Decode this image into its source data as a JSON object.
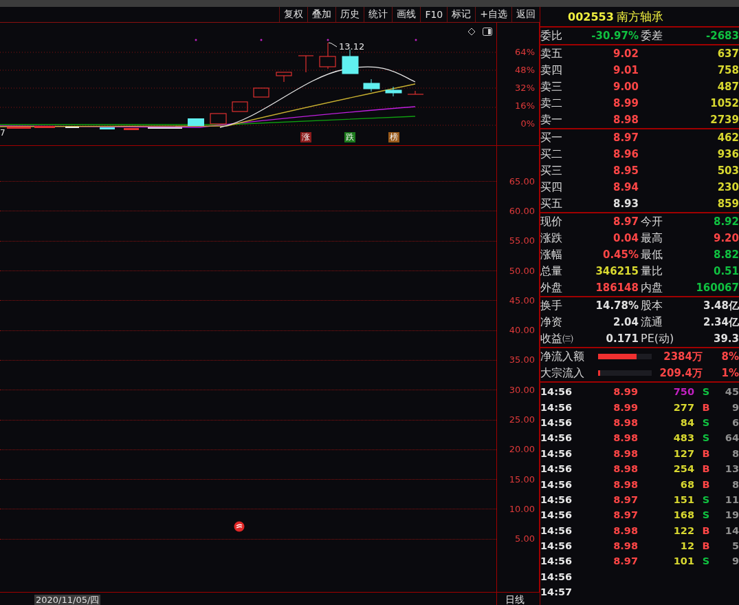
{
  "toolbar": [
    "复权",
    "叠加",
    "历史",
    "统计",
    "画线",
    "F10",
    "标记",
    "+自选",
    "返回"
  ],
  "top_chart": {
    "price_label": "13.12",
    "edge_label": "7",
    "axis_labels": [
      "64%",
      "48%",
      "32%",
      "16%",
      "0%"
    ],
    "markers": [
      {
        "label": "涨",
        "color": "#8c1c1c"
      },
      {
        "label": "跌",
        "color": "#1c7a1c"
      },
      {
        "label": "榜",
        "color": "#9a5a1a"
      }
    ]
  },
  "lower_chart": {
    "axis_labels": [
      "65.00",
      "60.00",
      "55.00",
      "50.00",
      "45.00",
      "40.00",
      "35.00",
      "30.00",
      "25.00",
      "20.00",
      "15.00",
      "10.00",
      "5.00"
    ]
  },
  "date_label": "2020/11/05/四",
  "period_label": "日线",
  "quote": {
    "code": "002553",
    "name": "南方轴承"
  },
  "ratio_row": [
    {
      "label": "委比",
      "value": "-30.97%",
      "color": "#10c040"
    },
    {
      "label": "委差",
      "value": "-2683",
      "color": "#10c040"
    }
  ],
  "asks": [
    {
      "label": "卖五",
      "price": "9.02",
      "color": "#ff4646",
      "volume": "637"
    },
    {
      "label": "卖四",
      "price": "9.01",
      "color": "#ff4646",
      "volume": "758"
    },
    {
      "label": "卖三",
      "price": "9.00",
      "color": "#ff4646",
      "volume": "487"
    },
    {
      "label": "卖二",
      "price": "8.99",
      "color": "#ff4646",
      "volume": "1052"
    },
    {
      "label": "卖一",
      "price": "8.98",
      "color": "#ff4646",
      "volume": "2739"
    }
  ],
  "bids": [
    {
      "label": "买一",
      "price": "8.97",
      "color": "#ff4646",
      "volume": "462"
    },
    {
      "label": "买二",
      "price": "8.96",
      "color": "#ff4646",
      "volume": "936"
    },
    {
      "label": "买三",
      "price": "8.95",
      "color": "#ff4646",
      "volume": "503"
    },
    {
      "label": "买四",
      "price": "8.94",
      "color": "#ff4646",
      "volume": "230"
    },
    {
      "label": "买五",
      "price": "8.93",
      "color": "#e0e0e0",
      "volume": "859"
    }
  ],
  "stats": [
    [
      {
        "label": "现价",
        "value": "8.97",
        "color": "#ff4646"
      },
      {
        "label": "今开",
        "value": "8.92",
        "color": "#10c040"
      }
    ],
    [
      {
        "label": "涨跌",
        "value": "0.04",
        "color": "#ff4646"
      },
      {
        "label": "最高",
        "value": "9.20",
        "color": "#ff4646"
      }
    ],
    [
      {
        "label": "涨幅",
        "value": "0.45%",
        "color": "#ff4646"
      },
      {
        "label": "最低",
        "value": "8.82",
        "color": "#10c040"
      }
    ],
    [
      {
        "label": "总量",
        "value": "346215",
        "color": "#d8d830"
      },
      {
        "label": "量比",
        "value": "0.51",
        "color": "#10c040"
      }
    ],
    [
      {
        "label": "外盘",
        "value": "186148",
        "color": "#ff4646"
      },
      {
        "label": "内盘",
        "value": "160067",
        "color": "#10c040"
      }
    ]
  ],
  "capital": [
    [
      {
        "label": "换手",
        "value": "14.78%"
      },
      {
        "label": "股本",
        "value": "3.48亿"
      }
    ],
    [
      {
        "label": "净资",
        "value": "2.04"
      },
      {
        "label": "流通",
        "value": "2.34亿"
      }
    ],
    [
      {
        "label": "收益㈢",
        "value": "0.171"
      },
      {
        "label": "PE(动)",
        "value": "39.3"
      }
    ]
  ],
  "fund_flow": [
    {
      "label": "净流入额",
      "level": 0.72,
      "amount": "2384万",
      "percent": "8%"
    },
    {
      "label": "大宗流入",
      "level": 0.04,
      "amount": "209.4万",
      "percent": "1%"
    }
  ],
  "trades": [
    {
      "time": "14:56",
      "price": "8.99",
      "volume": {
        "text": "750",
        "color": "#c020c0"
      },
      "side": {
        "text": "S",
        "color": "#10c040"
      },
      "count": "45"
    },
    {
      "time": "14:56",
      "price": "8.99",
      "volume": {
        "text": "277",
        "color": "#d8d830"
      },
      "side": {
        "text": "B",
        "color": "#ff4646"
      },
      "count": "9"
    },
    {
      "time": "14:56",
      "price": "8.98",
      "volume": {
        "text": "84",
        "color": "#d8d830"
      },
      "side": {
        "text": "S",
        "color": "#10c040"
      },
      "count": "6"
    },
    {
      "time": "14:56",
      "price": "8.98",
      "volume": {
        "text": "483",
        "color": "#d8d830"
      },
      "side": {
        "text": "S",
        "color": "#10c040"
      },
      "count": "64"
    },
    {
      "time": "14:56",
      "price": "8.98",
      "volume": {
        "text": "127",
        "color": "#d8d830"
      },
      "side": {
        "text": "B",
        "color": "#ff4646"
      },
      "count": "8"
    },
    {
      "time": "14:56",
      "price": "8.98",
      "volume": {
        "text": "254",
        "color": "#d8d830"
      },
      "side": {
        "text": "B",
        "color": "#ff4646"
      },
      "count": "13"
    },
    {
      "time": "14:56",
      "price": "8.98",
      "volume": {
        "text": "68",
        "color": "#d8d830"
      },
      "side": {
        "text": "B",
        "color": "#ff4646"
      },
      "count": "8"
    },
    {
      "time": "14:56",
      "price": "8.97",
      "volume": {
        "text": "151",
        "color": "#d8d830"
      },
      "side": {
        "text": "S",
        "color": "#10c040"
      },
      "count": "11"
    },
    {
      "time": "14:56",
      "price": "8.97",
      "volume": {
        "text": "168",
        "color": "#d8d830"
      },
      "side": {
        "text": "S",
        "color": "#10c040"
      },
      "count": "19"
    },
    {
      "time": "14:56",
      "price": "8.98",
      "volume": {
        "text": "122",
        "color": "#d8d830"
      },
      "side": {
        "text": "B",
        "color": "#ff4646"
      },
      "count": "14"
    },
    {
      "time": "14:56",
      "price": "8.98",
      "volume": {
        "text": "12",
        "color": "#d8d830"
      },
      "side": {
        "text": "B",
        "color": "#ff4646"
      },
      "count": "5"
    },
    {
      "time": "14:56",
      "price": "8.97",
      "volume": {
        "text": "101",
        "color": "#d8d830"
      },
      "side": {
        "text": "S",
        "color": "#10c040"
      },
      "count": "9"
    },
    {
      "time": "14:56"
    },
    {
      "time": "14:57"
    }
  ]
}
